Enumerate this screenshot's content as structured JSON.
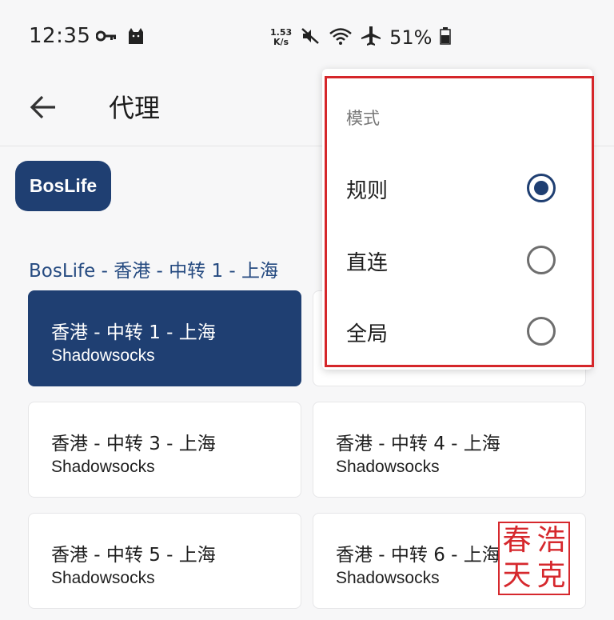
{
  "status_bar": {
    "time": "12:35",
    "speed_value": "1.53",
    "speed_unit": "K/s",
    "battery": "51%"
  },
  "app_bar": {
    "title": "代理"
  },
  "group_chip": {
    "label": "BosLife"
  },
  "current_selection": "BosLife - 香港 - 中转 1 - 上海",
  "proxies": [
    {
      "name": "香港 - 中转 1 - 上海",
      "type": "Shadowsocks",
      "selected": true
    },
    {
      "name": "香港 - 中转 3 - 上海",
      "type": "Shadowsocks",
      "selected": false
    },
    {
      "name": "香港 - 中转 4 - 上海",
      "type": "Shadowsocks",
      "selected": false
    },
    {
      "name": "香港 - 中转 5 - 上海",
      "type": "Shadowsocks",
      "selected": false
    },
    {
      "name": "香港 - 中转 6 - 上海",
      "type": "Shadowsocks",
      "selected": false
    }
  ],
  "mode_menu": {
    "header": "模式",
    "options": [
      {
        "label": "规则",
        "checked": true
      },
      {
        "label": "直连",
        "checked": false
      },
      {
        "label": "全局",
        "checked": false
      }
    ]
  },
  "watermark": {
    "chars": [
      "春",
      "浩",
      "天",
      "克"
    ]
  },
  "colors": {
    "accent": "#1f3f72",
    "highlight_border": "#d5262a",
    "seal": "#d6282d"
  },
  "icons": {
    "status_left": [
      "key-icon",
      "cat-icon"
    ],
    "status_right": [
      "mute-icon",
      "wifi-icon",
      "airplane-icon",
      "battery-icon"
    ],
    "app_bar": [
      "back-arrow-icon"
    ]
  }
}
